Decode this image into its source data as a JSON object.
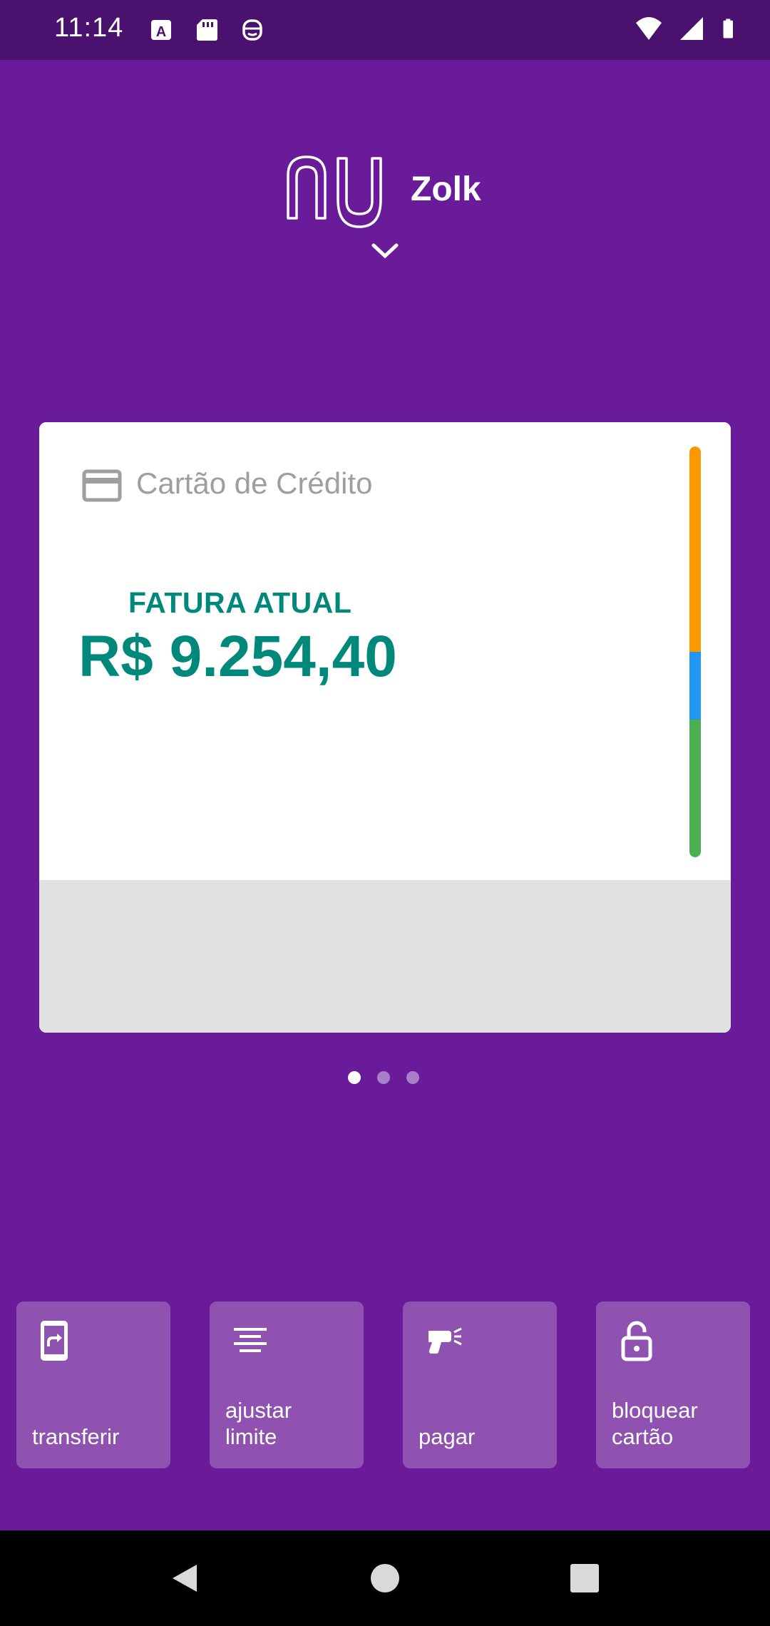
{
  "status_bar": {
    "time": "11:14",
    "left_icons": [
      "a-icon",
      "sd-card-icon",
      "face-icon"
    ],
    "right_icons": [
      "wifi-icon",
      "signal-icon",
      "battery-icon"
    ]
  },
  "header": {
    "logo": "nu-logo",
    "user_name": "Zolk",
    "chevron_icon": "chevron-down-icon"
  },
  "card": {
    "icon": "credit-card-icon",
    "title": "Cartão de Crédito",
    "invoice_label": "FATURA ATUAL",
    "invoice_amount": "R$ 9.254,40",
    "bar_segments": [
      {
        "color": "#FF9800",
        "fraction": 0.5
      },
      {
        "color": "#2196F3",
        "fraction": 0.165
      },
      {
        "color": "#4CAF50",
        "fraction": 0.335
      }
    ]
  },
  "pagination": {
    "count": 3,
    "active_index": 0
  },
  "actions": [
    {
      "label": "transferir",
      "icon": "phone-transfer-icon"
    },
    {
      "label": "ajustar\nlimite",
      "icon": "align-center-icon"
    },
    {
      "label": "pagar",
      "icon": "barcode-scanner-icon"
    },
    {
      "label": "bloquear\ncartão",
      "icon": "lock-open-icon"
    }
  ],
  "nav_bar": {
    "buttons": [
      "back-icon",
      "home-icon",
      "recents-icon"
    ]
  },
  "colors": {
    "primary": "#6A1B9A",
    "status_bar": "#4A126E",
    "accent_green": "#00897B",
    "tile": "#9052B0"
  }
}
